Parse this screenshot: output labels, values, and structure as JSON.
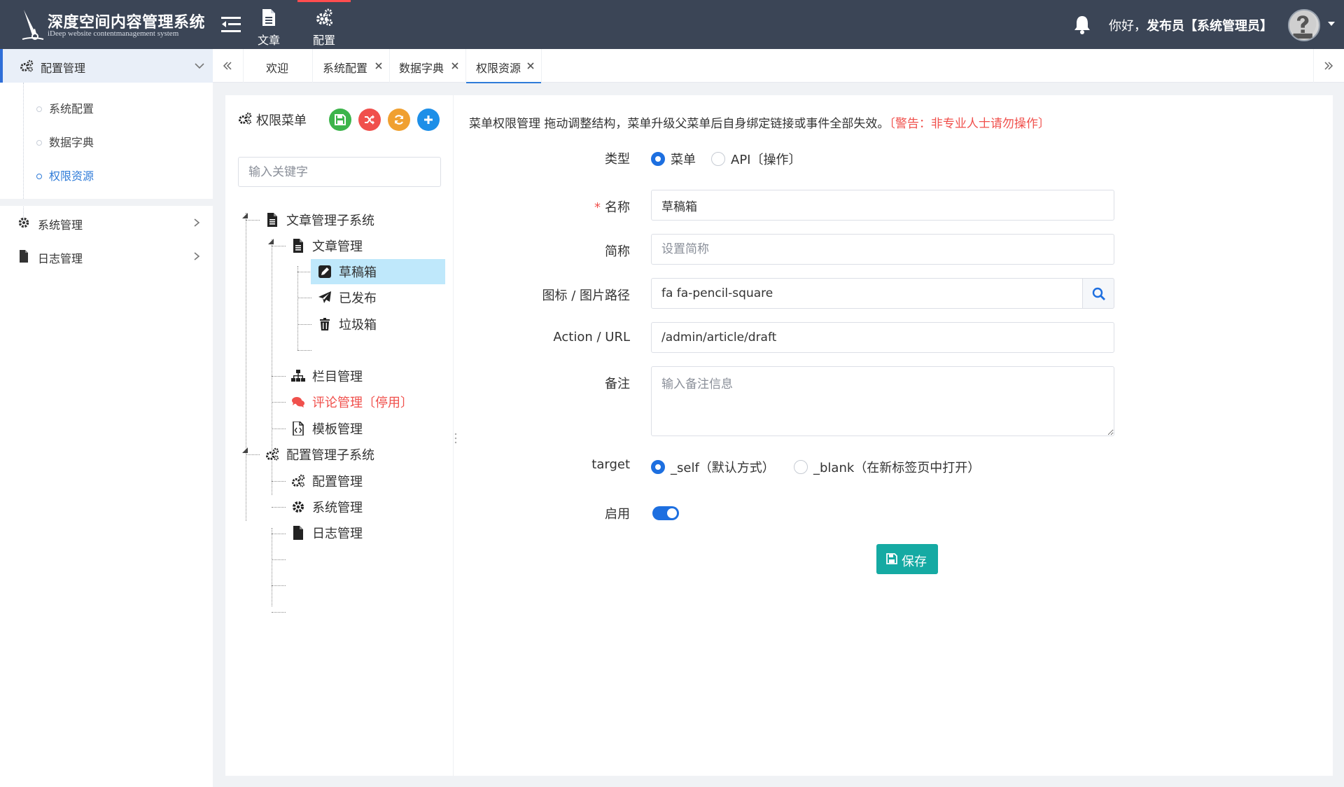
{
  "header": {
    "logo_title": "深度空间内容管理系统",
    "logo_subtitle": "iDeep website contentmanagement system",
    "nav": [
      {
        "label": "文章",
        "icon": "file-text-icon"
      },
      {
        "label": "配置",
        "icon": "cogs-icon"
      }
    ],
    "greeting_prefix": "你好，",
    "user_name": "发布员【系统管理员】"
  },
  "sidebar": {
    "groups": [
      {
        "label": "配置管理",
        "icon": "cogs-icon",
        "expanded": true,
        "items": [
          {
            "label": "系统配置"
          },
          {
            "label": "数据字典"
          },
          {
            "label": "权限资源",
            "active": true
          }
        ]
      },
      {
        "label": "系统管理",
        "icon": "gear-icon"
      },
      {
        "label": "日志管理",
        "icon": "file-icon"
      }
    ]
  },
  "tabs": [
    {
      "label": "欢迎",
      "closable": false
    },
    {
      "label": "系统配置",
      "closable": true
    },
    {
      "label": "数据字典",
      "closable": true
    },
    {
      "label": "权限资源",
      "closable": true,
      "active": true
    }
  ],
  "tree": {
    "title": "权限菜单",
    "search_placeholder": "输入关键字",
    "nodes": [
      {
        "label": "文章管理子系统",
        "icon": "file-text-icon"
      },
      {
        "label": "文章管理",
        "icon": "file-text-icon"
      },
      {
        "label": "草稿箱",
        "icon": "pencil-square-icon",
        "selected": true
      },
      {
        "label": "已发布",
        "icon": "paper-plane-icon"
      },
      {
        "label": "垃圾箱",
        "icon": "trash-icon"
      },
      {
        "label": "栏目管理",
        "icon": "sitemap-icon"
      },
      {
        "label": "评论管理〔停用〕",
        "icon": "comments-icon",
        "disabled": true
      },
      {
        "label": "模板管理",
        "icon": "file-code-icon"
      },
      {
        "label": "配置管理子系统",
        "icon": "cogs-icon"
      },
      {
        "label": "配置管理",
        "icon": "cogs-icon"
      },
      {
        "label": "系统管理",
        "icon": "gear-icon"
      },
      {
        "label": "日志管理",
        "icon": "file-icon"
      }
    ]
  },
  "form": {
    "notice": "菜单权限管理 拖动调整结构，菜单升级父菜单后自身绑定链接或事件全部失效。",
    "warning": "〔警告：非专业人士请勿操作〕",
    "type_label": "类型",
    "type_options": [
      {
        "label": "菜单",
        "checked": true
      },
      {
        "label": "API〔操作〕",
        "checked": false
      }
    ],
    "name_label": "名称",
    "name_value": "草稿箱",
    "short_label": "简称",
    "short_placeholder": "设置简称",
    "icon_label": "图标 / 图片路径",
    "icon_value": "fa fa-pencil-square",
    "url_label": "Action / URL",
    "url_value": "/admin/article/draft",
    "remark_label": "备注",
    "remark_placeholder": "输入备注信息",
    "target_label": "target",
    "target_options": [
      {
        "label": "_self（默认方式）",
        "checked": true
      },
      {
        "label": "_blank（在新标签页中打开）",
        "checked": false
      }
    ],
    "enabled_label": "启用",
    "enabled": true,
    "save_label": "保存"
  },
  "colors": {
    "topbar": "#3b4556",
    "accent": "#1d6fe0",
    "save": "#15aaa3",
    "danger": "#f0504c",
    "tree_selected": "#bfe8fb"
  }
}
